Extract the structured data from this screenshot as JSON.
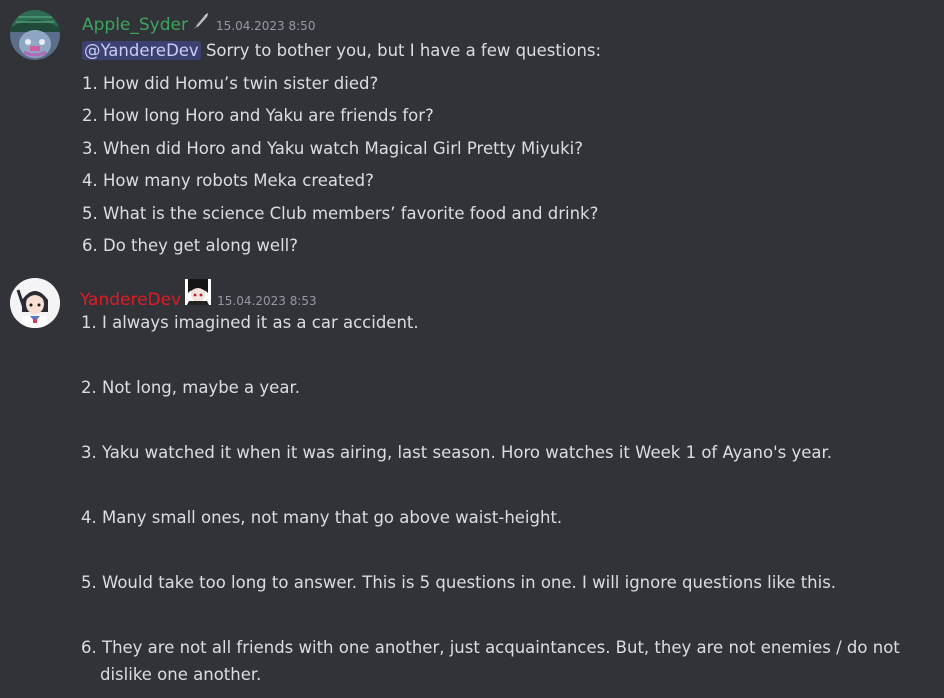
{
  "colors": {
    "background": "#313338",
    "text": "#dbdee1",
    "timestamp": "#949ba4",
    "mention_bg": "#3c4270",
    "mention_text": "#c9cdfb",
    "user1_name": "#3ba55d",
    "user2_name": "#e01b24"
  },
  "messages": [
    {
      "author": "Apple_Syder",
      "author_icon": "rocket-icon",
      "timestamp": "15.04.2023 8:50",
      "mention": "@YandereDev",
      "intro": " Sorry to bother you, but I have a few questions:",
      "lines": [
        "1. How did Homu’s twin sister died?",
        "2. How long Horo and Yaku are friends for?",
        "3. When did Horo and Yaku watch Magical Girl Pretty Miyuki?",
        "4. How many robots Meka created?",
        "5. What is the science Club members’ favorite food and drink?",
        "6. Do they get along well?"
      ]
    },
    {
      "author": "YandereDev",
      "author_icon": "anime-avatar-badge-icon",
      "timestamp": "15.04.2023 8:53",
      "answers": [
        "1. I always imagined it as a car accident.",
        "2. Not long, maybe a year.",
        "3. Yaku watched it when it was airing, last season. Horo watches it Week 1 of Ayano's year.",
        "4. Many small ones, not many that go above waist-height.",
        "5. Would take too long to answer. This is 5 questions in one. I will ignore questions like this.",
        "6. They are not all friends with one another, just acquaintances. But, they are not enemies / do not"
      ],
      "answer_6_continued": "dislike one another."
    }
  ]
}
